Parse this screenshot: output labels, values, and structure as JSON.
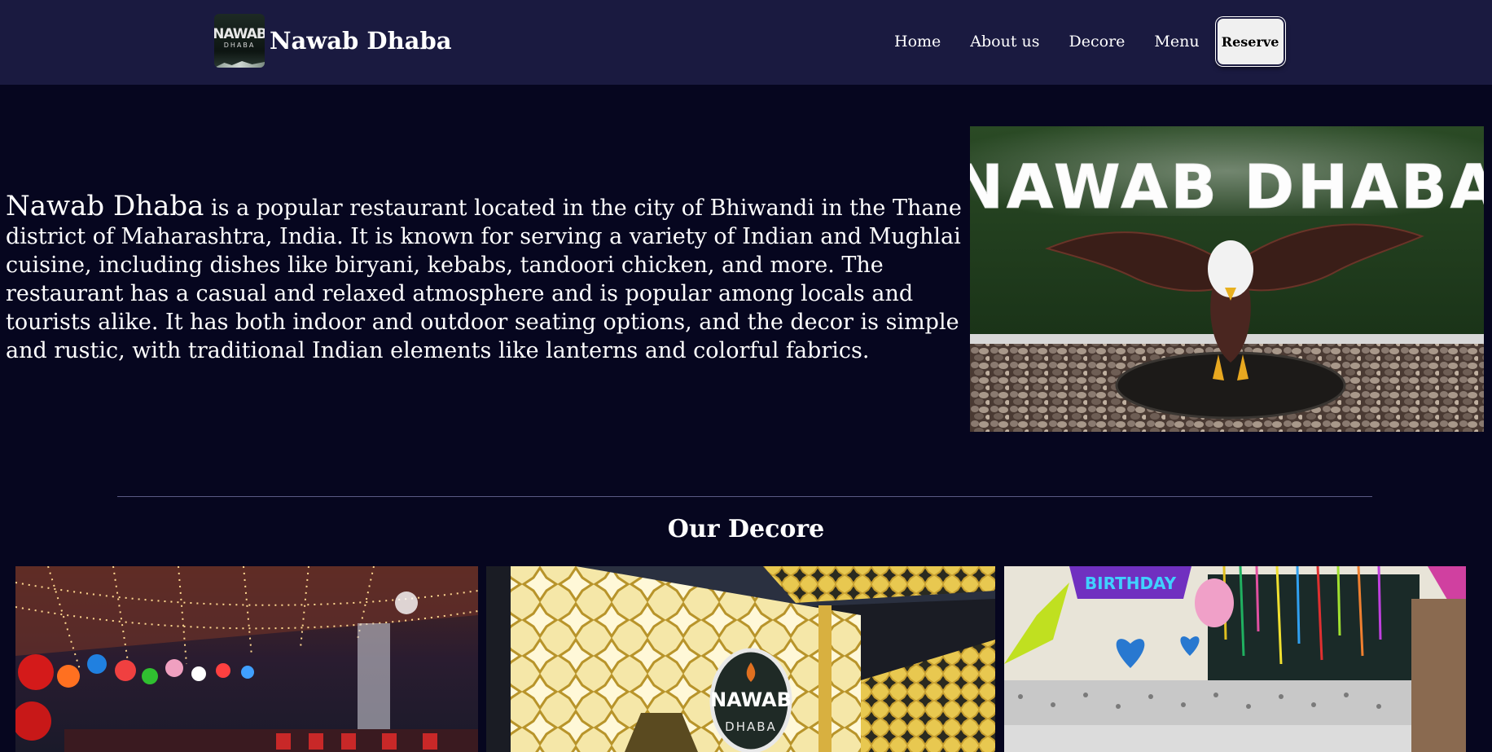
{
  "brand": {
    "logo_text_top": "NAWAB",
    "logo_text_bottom": "DHABA",
    "name": "Nawab Dhaba"
  },
  "nav": {
    "links": [
      "Home",
      "About us",
      "Decore",
      "Menu"
    ],
    "reserve_label": "Reserve"
  },
  "hero": {
    "name": "Nawab Dhaba",
    "description": " is a popular restaurant located in the city of Bhiwandi in the Thane district of Maharashtra, India. It is known for serving a variety of Indian and Mughlai cuisine, including dishes like biryani, kebabs, tandoori chicken, and more. The restaurant has a casual and relaxed atmosphere and is popular among locals and tourists alike. It has both indoor and outdoor seating options, and the decor is simple and rustic, with traditional Indian elements like lanterns and colorful fabrics.",
    "sign_text": "NAWAB DHABA"
  },
  "decor": {
    "title": "Our Decore",
    "photo2_logo_top": "NAWAB",
    "photo2_logo_bottom": "DHABA",
    "photo3_banner": "BIRTHDAY"
  },
  "colors": {
    "navbar_bg": "#1a1a40",
    "page_bg": "#06061f",
    "text": "#ffffff",
    "button_bg": "#f0f0f0"
  }
}
